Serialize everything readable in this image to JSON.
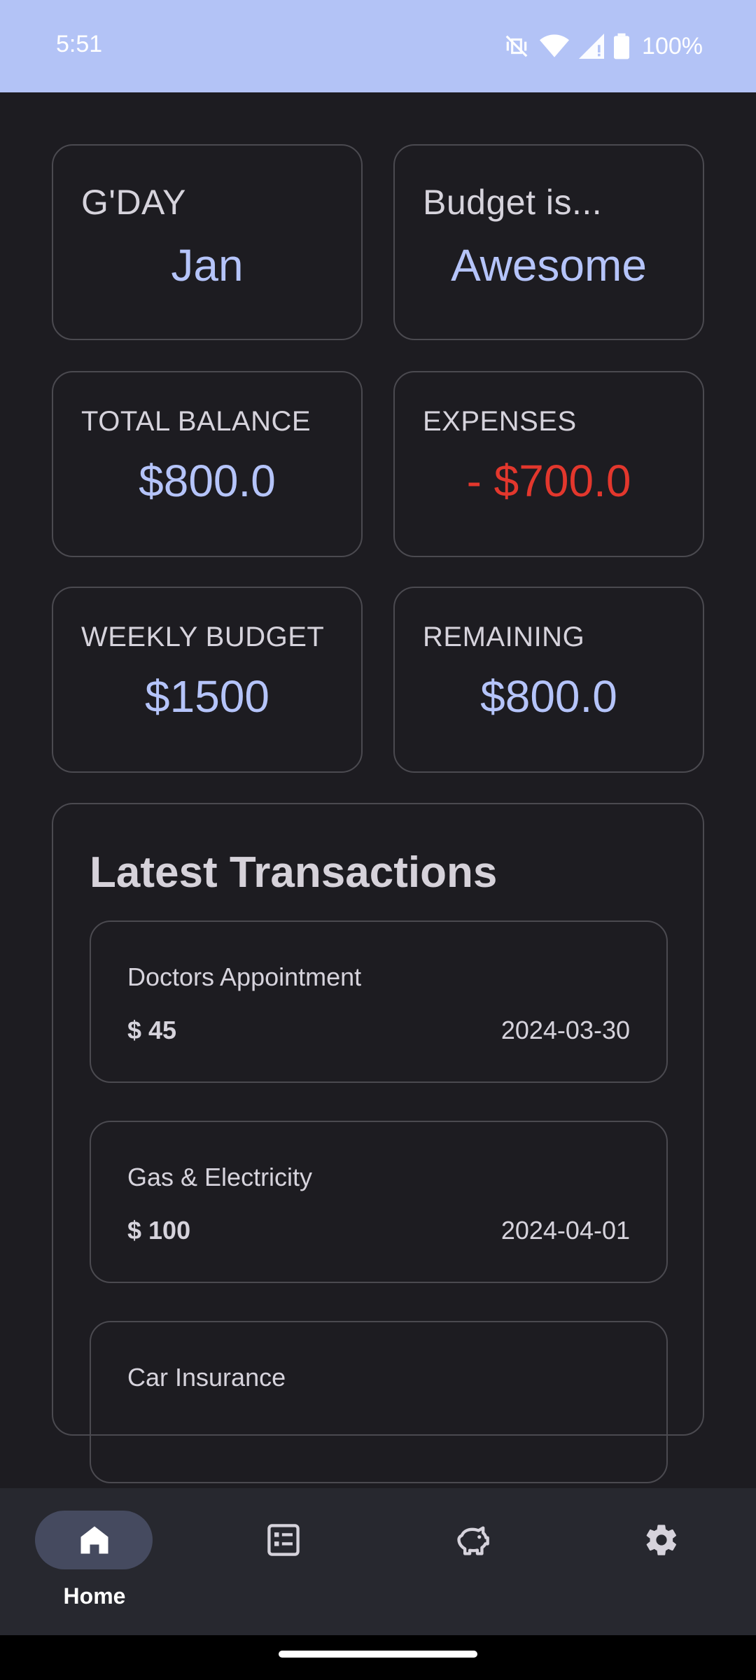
{
  "status_bar": {
    "time": "5:51",
    "battery": "100%"
  },
  "cards": {
    "greeting": {
      "label": "G'DAY",
      "value": "Jan"
    },
    "budget_status": {
      "label": "Budget is...",
      "value": "Awesome"
    },
    "total_balance": {
      "label": "TOTAL BALANCE",
      "value": "$800.0"
    },
    "expenses": {
      "label": "EXPENSES",
      "value": "- $700.0"
    },
    "weekly_budget": {
      "label": "WEEKLY BUDGET",
      "value": "$1500"
    },
    "remaining": {
      "label": "REMAINING",
      "value": "$800.0"
    }
  },
  "transactions": {
    "title": "Latest Transactions",
    "items": [
      {
        "name": "Doctors Appointment",
        "amount": "$ 45",
        "date": "2024-03-30"
      },
      {
        "name": "Gas & Electricity",
        "amount": "$ 100",
        "date": "2024-04-01"
      },
      {
        "name": "Car Insurance",
        "amount": "",
        "date": ""
      }
    ]
  },
  "bottom_nav": {
    "items": [
      {
        "label": "Home",
        "icon": "home-icon",
        "selected": true
      },
      {
        "label": "",
        "icon": "list-icon",
        "selected": false
      },
      {
        "label": "",
        "icon": "piggy-bank-icon",
        "selected": false
      },
      {
        "label": "",
        "icon": "settings-icon",
        "selected": false
      }
    ]
  },
  "colors": {
    "background": "#1d1c21",
    "accent": "#b5c4fa",
    "negative": "#e3372d",
    "status_bar": "#b3c3f6",
    "nav_background": "#27282f"
  }
}
